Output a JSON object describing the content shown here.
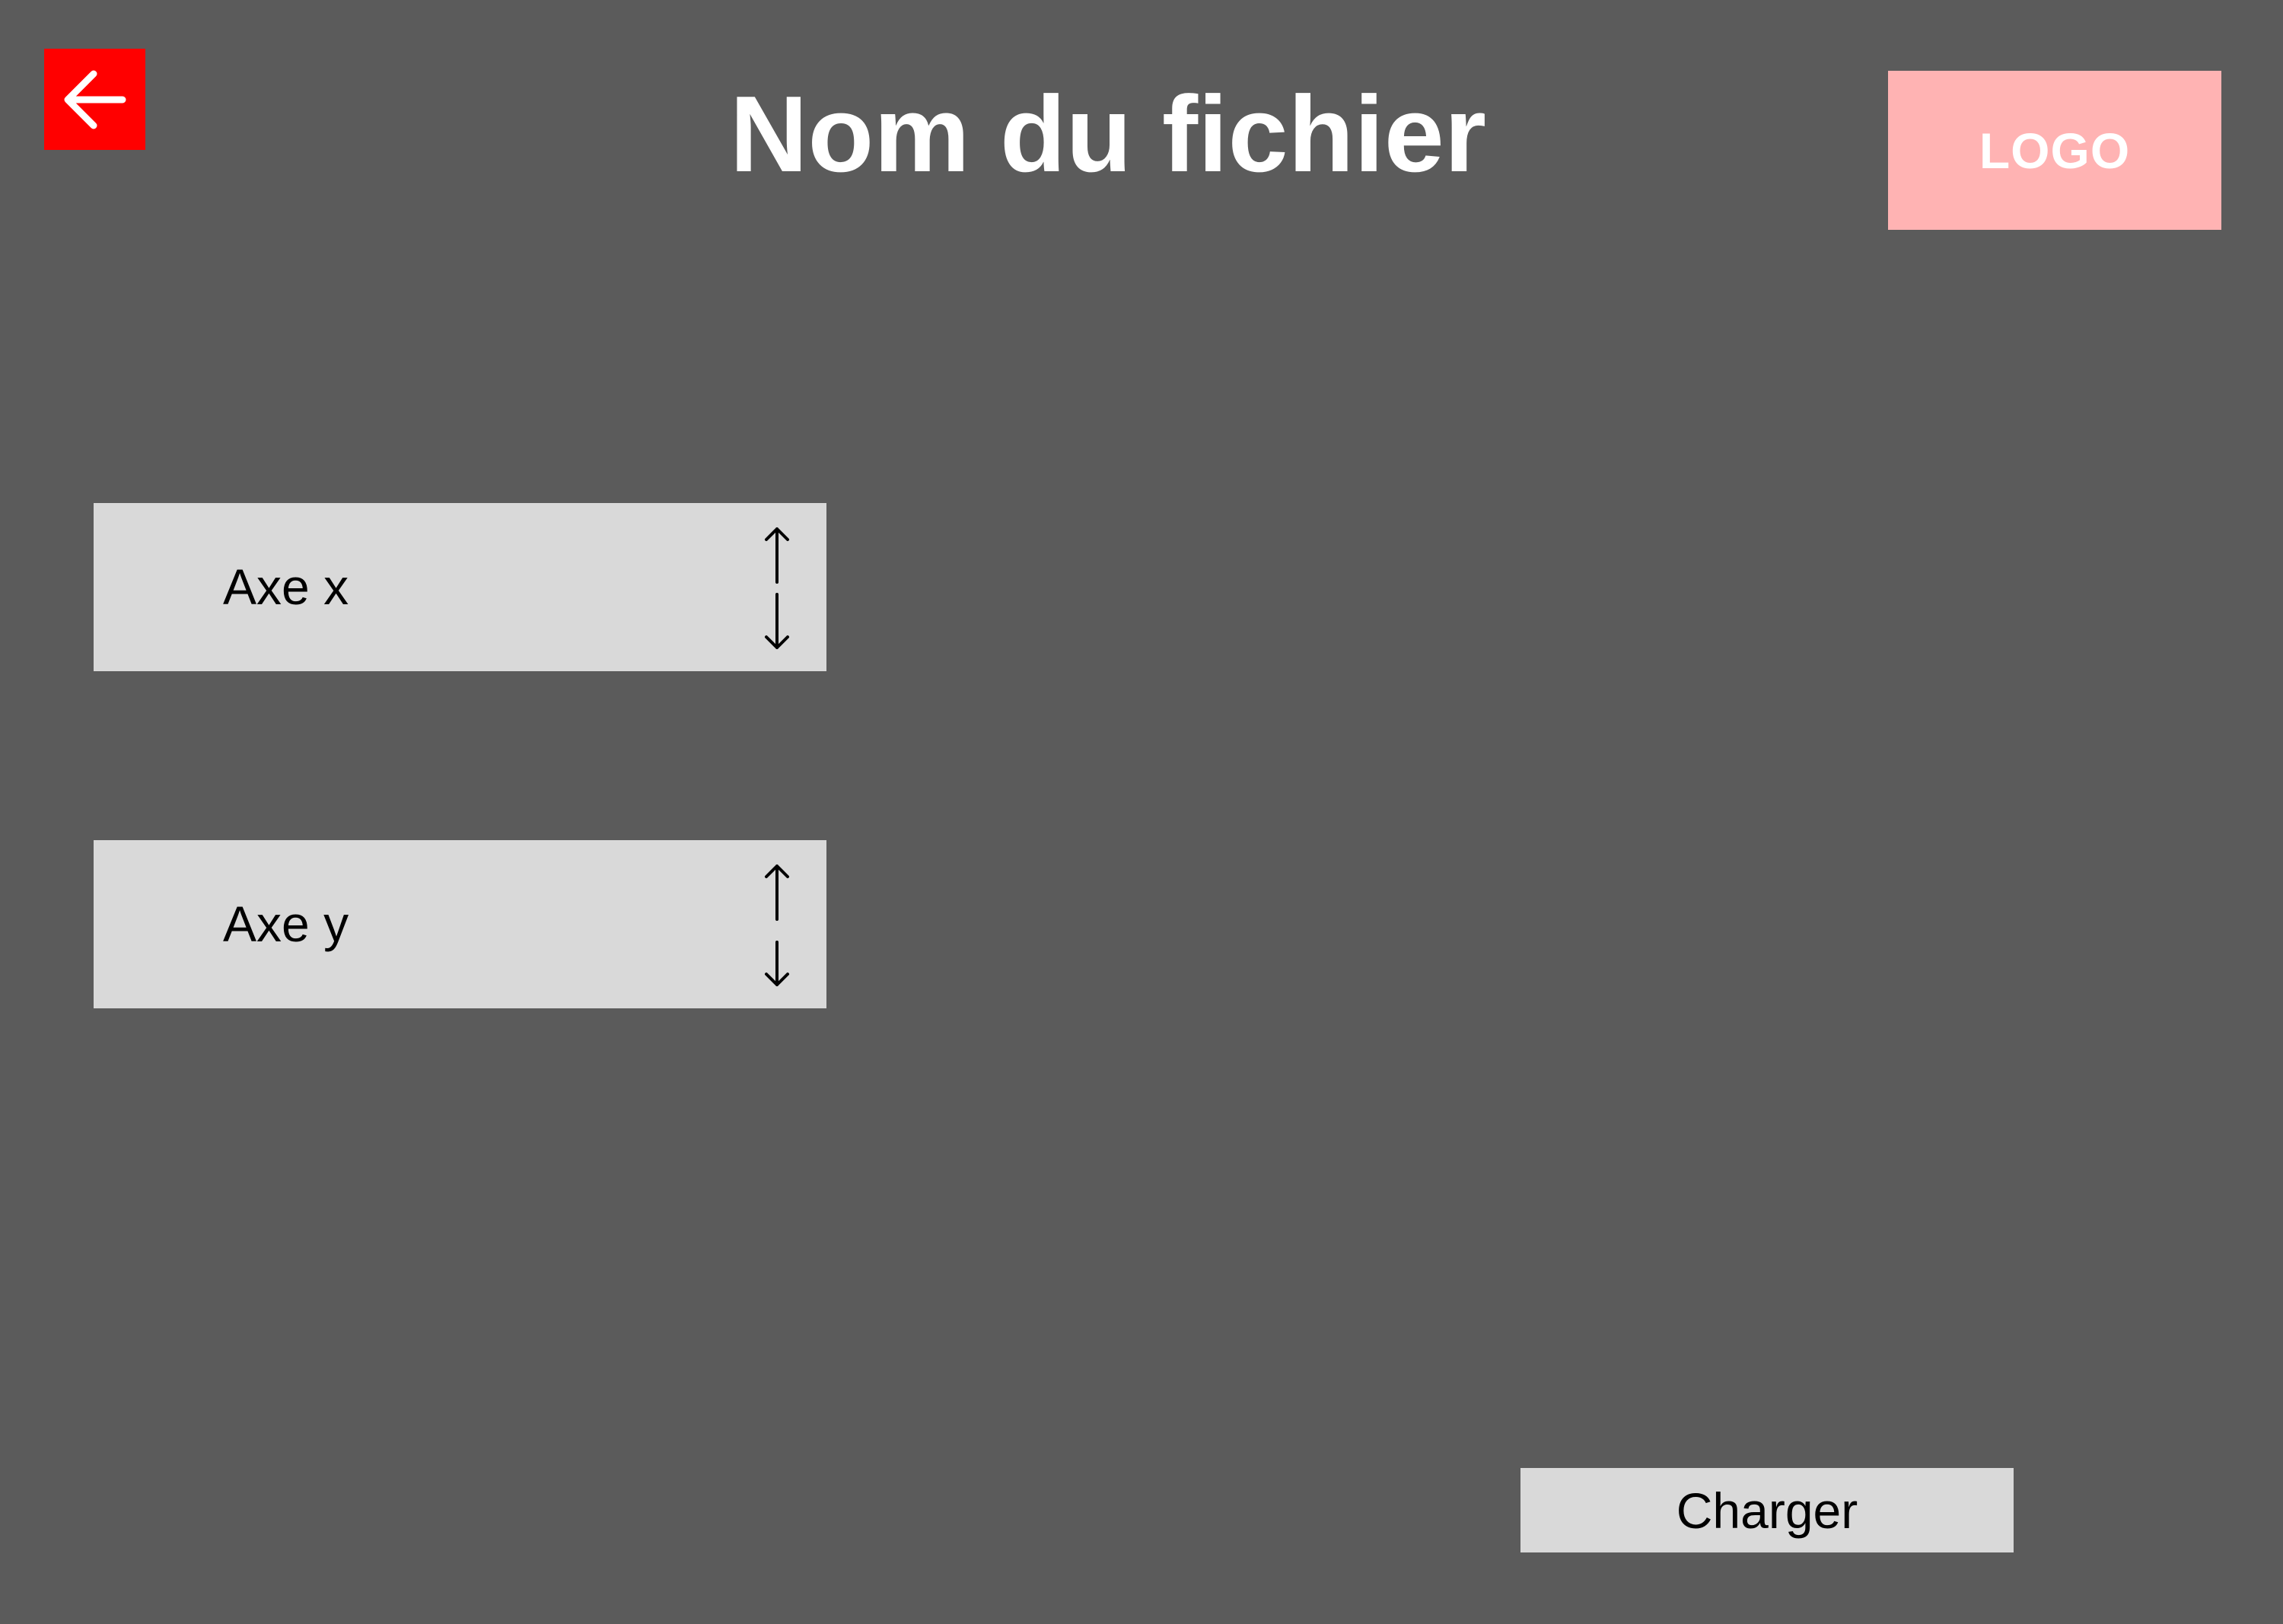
{
  "header": {
    "title": "Nom du fichier",
    "logo_text": "LOGO",
    "back_icon": "arrow-left-icon"
  },
  "axes": {
    "x": {
      "label": "Axe x",
      "icon": "up-down-arrows-icon"
    },
    "y": {
      "label": "Axe y",
      "icon": "up-down-arrows-icon"
    }
  },
  "actions": {
    "load_label": "Charger"
  },
  "colors": {
    "background": "#5b5b5b",
    "back_button": "#ff0000",
    "logo_background": "#ffb3b3",
    "control_background": "#d9d9d9"
  }
}
